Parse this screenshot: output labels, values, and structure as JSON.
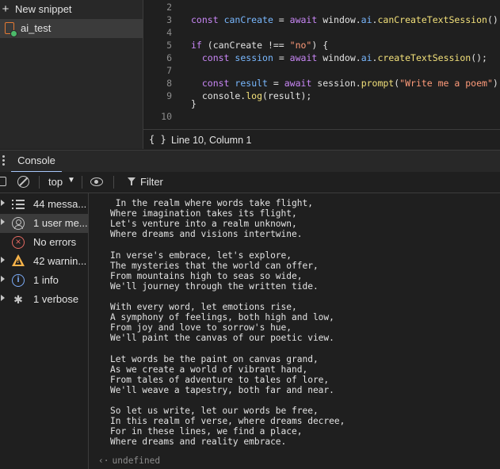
{
  "snippets": {
    "new_label": "New snippet",
    "items": [
      {
        "label": "ai_test"
      }
    ]
  },
  "editor": {
    "line_numbers": [
      "2",
      "3",
      "4",
      "5",
      "6",
      "7",
      "8",
      "9",
      "10"
    ],
    "lines": [
      "",
      "const canCreate = await window.ai.canCreateTextSession();",
      "",
      "if (canCreate !== \"no\") {",
      "  const session = await window.ai.createTextSession();",
      "",
      "  const result = await session.prompt(\"Write me a poem\");",
      "  console.log(result);",
      "}"
    ]
  },
  "status_bar": {
    "format_icon": "{ }",
    "position": "Line 10, Column 1"
  },
  "drawer": {
    "tabs": [
      {
        "label": "Console",
        "active": true
      }
    ]
  },
  "toolbar": {
    "context": "top",
    "filter_placeholder": "Filter"
  },
  "sidebar": {
    "items": [
      {
        "label": "44 messa...",
        "icon": "list-icon"
      },
      {
        "label": "1 user me...",
        "icon": "user-icon"
      },
      {
        "label": "No errors",
        "icon": "error-icon"
      },
      {
        "label": "42 warnin...",
        "icon": "warning-icon"
      },
      {
        "label": "1 info",
        "icon": "info-icon"
      },
      {
        "label": "1 verbose",
        "icon": "bug-icon"
      }
    ]
  },
  "console": {
    "poem": [
      " In the realm where words take flight,",
      "Where imagination takes its flight,",
      "Let's venture into a realm unknown,",
      "Where dreams and visions intertwine.",
      "",
      "In verse's embrace, let's explore,",
      "The mysteries that the world can offer,",
      "From mountains high to seas so wide,",
      "We'll journey through the written tide.",
      "",
      "With every word, let emotions rise,",
      "A symphony of feelings, both high and low,",
      "From joy and love to sorrow's hue,",
      "We'll paint the canvas of our poetic view.",
      "",
      "Let words be the paint on canvas grand,",
      "As we create a world of vibrant hand,",
      "From tales of adventure to tales of lore,",
      "We'll weave a tapestry, both far and near.",
      "",
      "So let us write, let our words be free,",
      "In this realm of verse, where dreams decree,",
      "For in these lines, we find a place,",
      "Where dreams and reality embrace."
    ],
    "return_value": "undefined",
    "return_arrow": "‹·"
  }
}
